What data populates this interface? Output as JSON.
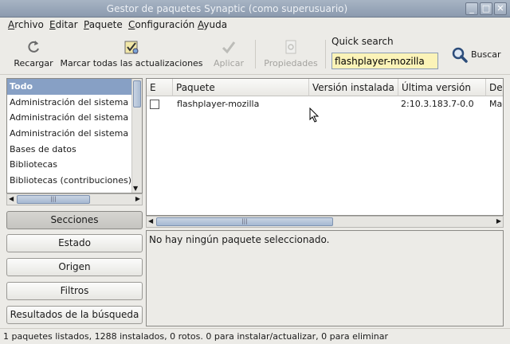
{
  "window": {
    "title": "Gestor de paquetes Synaptic (como superusuario)"
  },
  "menu": {
    "items": [
      {
        "mnemonic": "A",
        "rest": "rchivo"
      },
      {
        "mnemonic": "E",
        "rest": "ditar"
      },
      {
        "mnemonic": "P",
        "rest": "aquete"
      },
      {
        "mnemonic": "C",
        "rest": "onfiguración"
      },
      {
        "mnemonic": "A",
        "rest": "yuda"
      }
    ]
  },
  "toolbar": {
    "reload": "Recargar",
    "mark_all": "Marcar todas las actualizaciones",
    "apply": "Aplicar",
    "properties": "Propiedades",
    "quick_search_label": "Quick search",
    "quick_search_value": "flashplayer-mozilla",
    "search": "Buscar"
  },
  "categories": {
    "items": [
      "Todo",
      "Administración del sistema",
      "Administración del sistema",
      "Administración del sistema",
      "Bases de datos",
      "Bibliotecas",
      "Bibliotecas (contribuciones)"
    ],
    "selected_index": 0
  },
  "filter_buttons": {
    "sections": "Secciones",
    "status": "Estado",
    "origin": "Origen",
    "filters": "Filtros",
    "search_results": "Resultados de la búsqueda"
  },
  "package_table": {
    "columns": {
      "state": "E",
      "package": "Paquete",
      "installed_version": "Versión instalada",
      "latest_version": "Última versión",
      "description": "Des"
    },
    "rows": [
      {
        "checked": false,
        "package": "flashplayer-mozilla",
        "installed_version": "",
        "latest_version": "2:10.3.183.7-0.0",
        "description": "Mac"
      }
    ]
  },
  "details": {
    "message": "No hay ningún paquete seleccionado."
  },
  "status": {
    "text": "1 paquetes listados, 1288 instalados, 0 rotos. 0 para instalar/actualizar, 0 para eliminar"
  },
  "colors": {
    "selection": "#87a0c5",
    "titlebar": "#99a7b9",
    "quick_search_bg": "#fbf3b8"
  }
}
